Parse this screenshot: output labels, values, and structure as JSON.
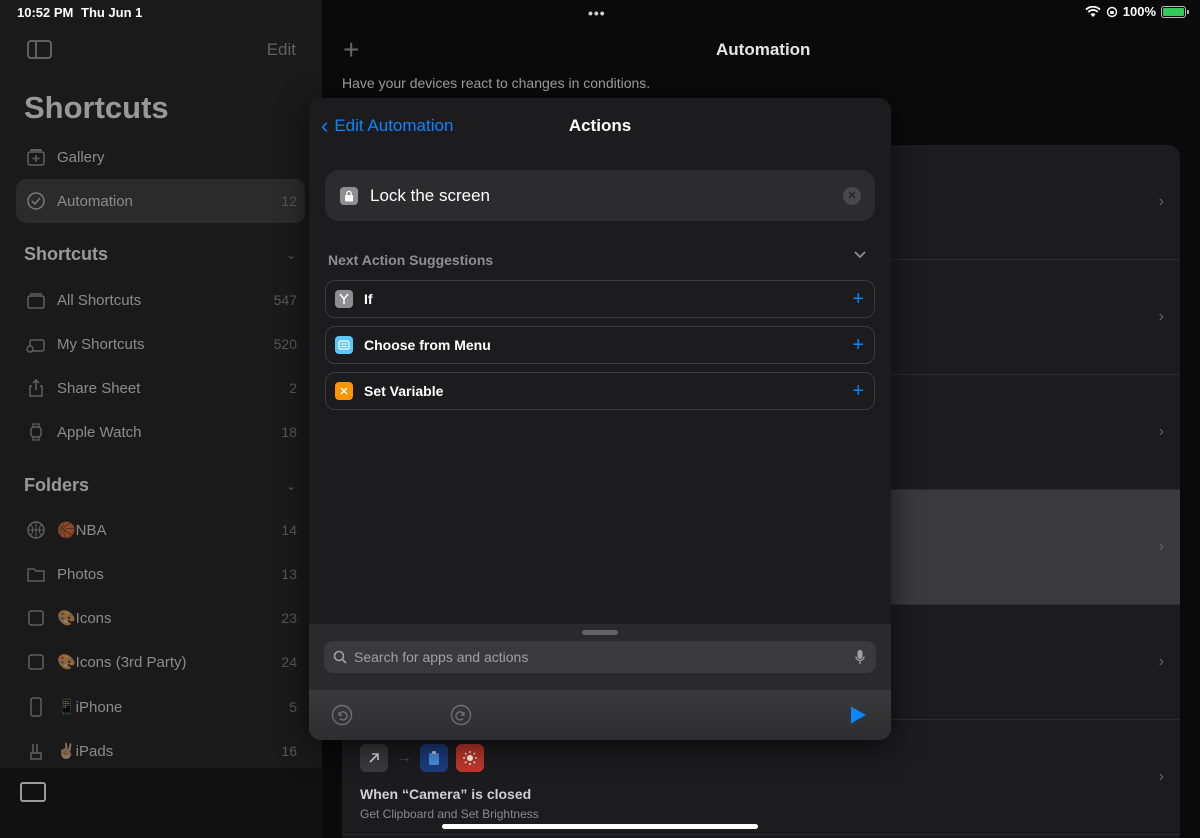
{
  "status_bar": {
    "time": "10:52 PM",
    "date": "Thu Jun 1",
    "dots": "•••",
    "battery_percent": "100%"
  },
  "sidebar": {
    "edit_label": "Edit",
    "title": "Shortcuts",
    "top_items": [
      {
        "label": "Gallery",
        "icon": "gallery-icon",
        "count": ""
      },
      {
        "label": "Automation",
        "icon": "automation-icon",
        "count": "12",
        "active": true
      }
    ],
    "shortcuts_section": "Shortcuts",
    "shortcut_items": [
      {
        "label": "All Shortcuts",
        "icon": "stack-icon",
        "count": "547"
      },
      {
        "label": "My Shortcuts",
        "icon": "person-stack-icon",
        "count": "520"
      },
      {
        "label": "Share Sheet",
        "icon": "share-icon",
        "count": "2"
      },
      {
        "label": "Apple Watch",
        "icon": "watch-icon",
        "count": "18"
      }
    ],
    "folders_section": "Folders",
    "folder_items": [
      {
        "label": "🏀NBA",
        "icon": "basketball-icon",
        "count": "14"
      },
      {
        "label": "Photos",
        "icon": "folder-icon",
        "count": "13"
      },
      {
        "label": "🎨Icons",
        "icon": "square-icon",
        "count": "23"
      },
      {
        "label": "🎨Icons (3rd Party)",
        "icon": "square-icon",
        "count": "24"
      },
      {
        "label": "📱iPhone",
        "icon": "phone-icon",
        "count": "5"
      },
      {
        "label": "✌🏼iPads",
        "icon": "peace-icon",
        "count": "16"
      }
    ]
  },
  "main": {
    "title": "Automation",
    "subtitle": "Have your devices react to changes in conditions.",
    "last_row": {
      "title": "When “Camera” is closed",
      "subtitle": "Get Clipboard and Set Brightness"
    }
  },
  "modal": {
    "back_label": "Edit Automation",
    "title": "Actions",
    "action": "Lock the screen",
    "suggestions_header": "Next Action Suggestions",
    "suggestions": [
      {
        "label": "If",
        "color": "#8e8e93"
      },
      {
        "label": "Choose from Menu",
        "color": "#5ac8fa"
      },
      {
        "label": "Set Variable",
        "color": "#ff9500"
      }
    ],
    "search_placeholder": "Search for apps and actions"
  },
  "colors": {
    "accent": "#0a84ff",
    "battery": "#34c759"
  }
}
